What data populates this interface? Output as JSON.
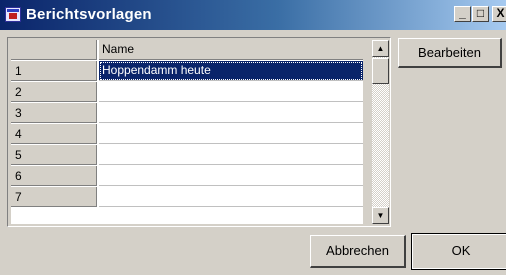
{
  "window": {
    "title": "Berichtsvorlagen",
    "icon": "report-app-icon",
    "controls": {
      "minimize": "_",
      "maximize": "□",
      "close": "X"
    }
  },
  "grid": {
    "column_header": "Name",
    "rows": [
      {
        "num": "1",
        "name": "Hoppendamm heute",
        "selected": true
      },
      {
        "num": "2",
        "name": ""
      },
      {
        "num": "3",
        "name": ""
      },
      {
        "num": "4",
        "name": ""
      },
      {
        "num": "5",
        "name": ""
      },
      {
        "num": "6",
        "name": ""
      },
      {
        "num": "7",
        "name": ""
      }
    ],
    "scroll_up": "▲",
    "scroll_down": "▼"
  },
  "buttons": {
    "edit": "Bearbeiten",
    "cancel": "Abbrechen",
    "ok": "OK"
  },
  "colors": {
    "titlebar_start": "#0a246a",
    "titlebar_end": "#a6caf0",
    "selection": "#0a246a",
    "face": "#d4d0c8"
  }
}
